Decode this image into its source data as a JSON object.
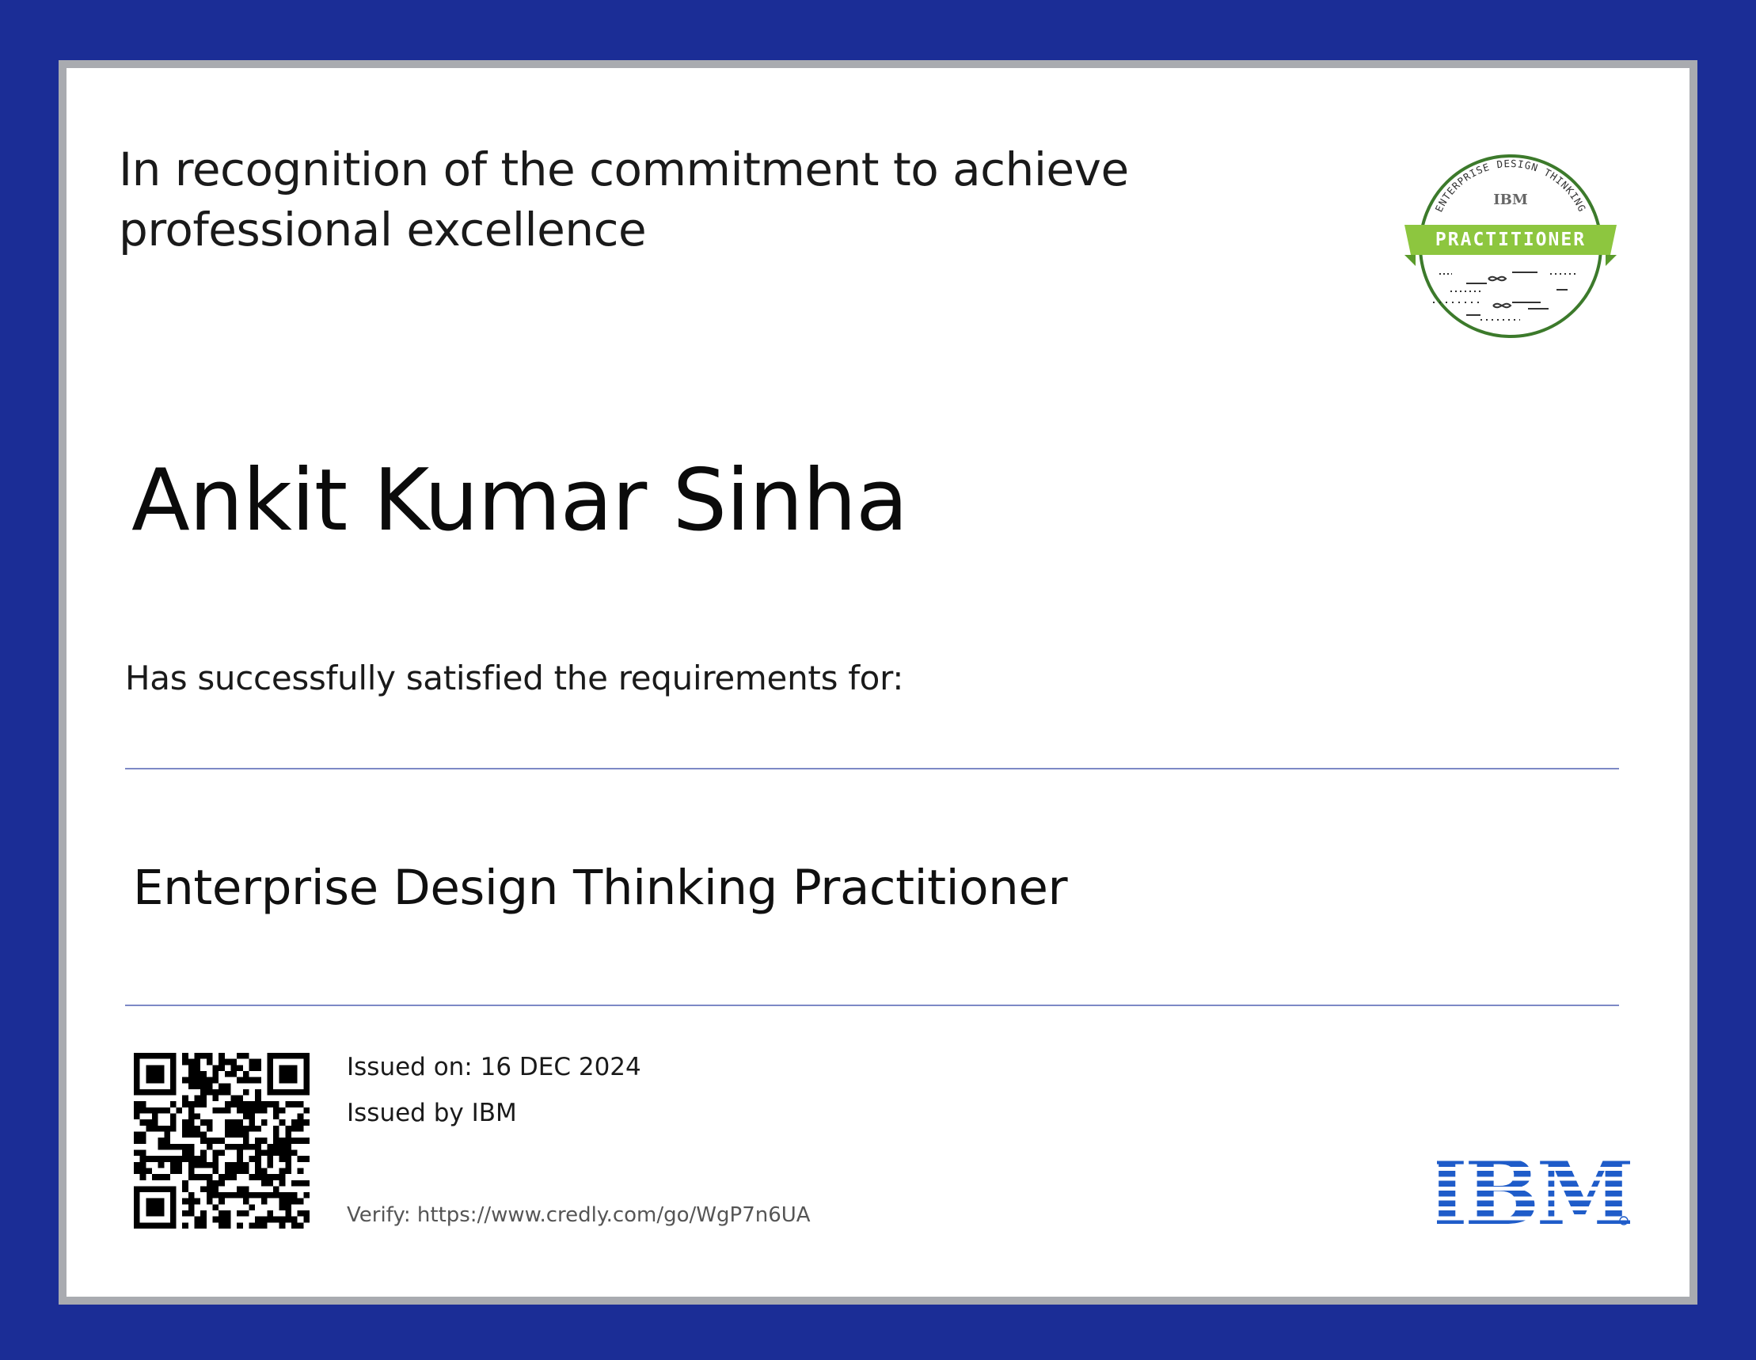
{
  "certificate": {
    "recognition_text": "In recognition of the commitment to achieve professional excellence",
    "recipient_name": "Ankit Kumar Sinha",
    "satisfied_text": "Has successfully satisfied the requirements for:",
    "credential_title": "Enterprise Design Thinking Practitioner",
    "issued_on": "Issued on: 16 DEC 2024",
    "issued_by": "Issued by IBM",
    "verify": "Verify: https://www.credly.com/go/WgP7n6UA"
  },
  "badge": {
    "arc_text": "ENTERPRISE DESIGN THINKING",
    "brand": "IBM",
    "level": "PRACTITIONER",
    "ribbon_color": "#8dc63f",
    "ring_color": "#3c7a2b"
  },
  "logo": {
    "brand": "IBM",
    "color": "#1f5cc9"
  },
  "colors": {
    "background": "#1b2d96",
    "rule": "#7d89c6"
  },
  "icons": {
    "qr": "qr-code-icon"
  }
}
